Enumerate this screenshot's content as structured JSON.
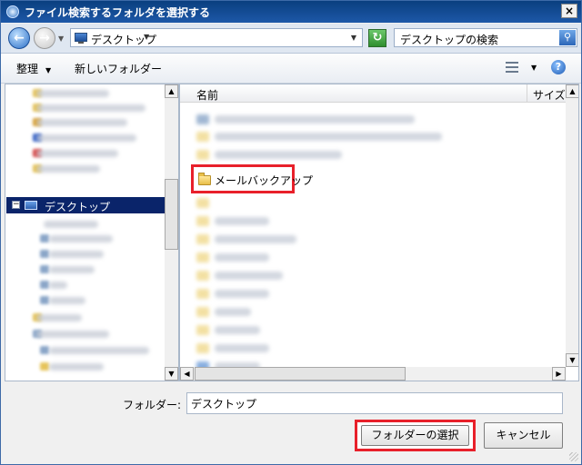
{
  "window": {
    "title": "ファイル検索するフォルダを選択する",
    "close_glyph": "×"
  },
  "address": {
    "location": "デスクトップ",
    "search_placeholder": "デスクトップの検索"
  },
  "toolbar": {
    "organize": "整理",
    "new_folder": "新しいフォルダー"
  },
  "nav_tree": {
    "selected_item": "デスクトップ"
  },
  "file_list": {
    "columns": [
      "名前",
      "サイズ"
    ],
    "highlighted_item": "メールバックアップ"
  },
  "footer": {
    "folder_label": "フォルダー:",
    "folder_value": "デスクトップ",
    "select_button": "フォルダーの選択",
    "cancel_button": "キャンセル"
  },
  "colors": {
    "highlight_border": "#e8202a",
    "selection_bg": "#0a246a",
    "title_bar": "#0a3f7f"
  },
  "icons": [
    "dialog-icon",
    "back-icon",
    "forward-icon",
    "monitor-icon",
    "refresh-icon",
    "search-icon",
    "view-icon",
    "help-icon",
    "folder-icon"
  ]
}
